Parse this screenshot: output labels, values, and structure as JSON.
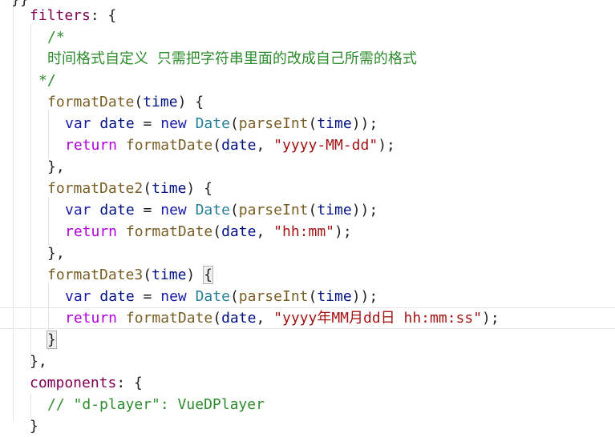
{
  "editor": {
    "lines": [
      {
        "text": "}}"
      },
      {
        "tokens": [
          {
            "t": "filters",
            "c": "prop"
          },
          {
            "t": ": {",
            "c": "punc"
          }
        ]
      },
      {
        "tokens": [
          {
            "t": "/*",
            "c": "cm"
          }
        ]
      },
      {
        "tokens": [
          {
            "t": "时间格式自定义 只需把字符串里面的改成自己所需的格式",
            "c": "cm"
          }
        ]
      },
      {
        "tokens": [
          {
            "t": "*/",
            "c": "cm"
          }
        ]
      },
      {
        "tokens": [
          {
            "t": "formatDate",
            "c": "fn"
          },
          {
            "t": "(",
            "c": "punc"
          },
          {
            "t": "time",
            "c": "id"
          },
          {
            "t": ") {",
            "c": "punc"
          }
        ]
      },
      {
        "tokens": [
          {
            "t": "var",
            "c": "kw"
          },
          {
            "t": " ",
            "c": "punc"
          },
          {
            "t": "date",
            "c": "id"
          },
          {
            "t": " = ",
            "c": "punc"
          },
          {
            "t": "new",
            "c": "kw"
          },
          {
            "t": " ",
            "c": "punc"
          },
          {
            "t": "Date",
            "c": "cls"
          },
          {
            "t": "(",
            "c": "punc"
          },
          {
            "t": "parseInt",
            "c": "fn"
          },
          {
            "t": "(",
            "c": "punc"
          },
          {
            "t": "time",
            "c": "id"
          },
          {
            "t": "));",
            "c": "punc"
          }
        ]
      },
      {
        "tokens": [
          {
            "t": "return",
            "c": "ctrl"
          },
          {
            "t": " ",
            "c": "punc"
          },
          {
            "t": "formatDate",
            "c": "fn"
          },
          {
            "t": "(",
            "c": "punc"
          },
          {
            "t": "date",
            "c": "id"
          },
          {
            "t": ", ",
            "c": "punc"
          },
          {
            "t": "\"yyyy-MM-dd\"",
            "c": "str"
          },
          {
            "t": ");",
            "c": "punc"
          }
        ]
      },
      {
        "tokens": [
          {
            "t": "},",
            "c": "punc"
          }
        ]
      },
      {
        "tokens": [
          {
            "t": "formatDate2",
            "c": "fn"
          },
          {
            "t": "(",
            "c": "punc"
          },
          {
            "t": "time",
            "c": "id"
          },
          {
            "t": ") {",
            "c": "punc"
          }
        ]
      },
      {
        "tokens": [
          {
            "t": "var",
            "c": "kw"
          },
          {
            "t": " ",
            "c": "punc"
          },
          {
            "t": "date",
            "c": "id"
          },
          {
            "t": " = ",
            "c": "punc"
          },
          {
            "t": "new",
            "c": "kw"
          },
          {
            "t": " ",
            "c": "punc"
          },
          {
            "t": "Date",
            "c": "cls"
          },
          {
            "t": "(",
            "c": "punc"
          },
          {
            "t": "parseInt",
            "c": "fn"
          },
          {
            "t": "(",
            "c": "punc"
          },
          {
            "t": "time",
            "c": "id"
          },
          {
            "t": "));",
            "c": "punc"
          }
        ]
      },
      {
        "tokens": [
          {
            "t": "return",
            "c": "ctrl"
          },
          {
            "t": " ",
            "c": "punc"
          },
          {
            "t": "formatDate",
            "c": "fn"
          },
          {
            "t": "(",
            "c": "punc"
          },
          {
            "t": "date",
            "c": "id"
          },
          {
            "t": ", ",
            "c": "punc"
          },
          {
            "t": "\"hh:mm\"",
            "c": "str"
          },
          {
            "t": ");",
            "c": "punc"
          }
        ]
      },
      {
        "tokens": [
          {
            "t": "},",
            "c": "punc"
          }
        ]
      },
      {
        "tokens": [
          {
            "t": "formatDate3",
            "c": "fn"
          },
          {
            "t": "(",
            "c": "punc"
          },
          {
            "t": "time",
            "c": "id"
          },
          {
            "t": ") ",
            "c": "punc"
          },
          {
            "t": "{",
            "c": "punc",
            "match": true
          }
        ]
      },
      {
        "tokens": [
          {
            "t": "var",
            "c": "kw"
          },
          {
            "t": " ",
            "c": "punc"
          },
          {
            "t": "date",
            "c": "id"
          },
          {
            "t": " = ",
            "c": "punc"
          },
          {
            "t": "new",
            "c": "kw"
          },
          {
            "t": " ",
            "c": "punc"
          },
          {
            "t": "Date",
            "c": "cls"
          },
          {
            "t": "(",
            "c": "punc"
          },
          {
            "t": "parseInt",
            "c": "fn"
          },
          {
            "t": "(",
            "c": "punc"
          },
          {
            "t": "time",
            "c": "id"
          },
          {
            "t": "));",
            "c": "punc"
          }
        ]
      },
      {
        "tokens": [
          {
            "t": "return",
            "c": "ctrl"
          },
          {
            "t": " ",
            "c": "punc"
          },
          {
            "t": "formatDate",
            "c": "fn"
          },
          {
            "t": "(",
            "c": "punc"
          },
          {
            "t": "date",
            "c": "id"
          },
          {
            "t": ", ",
            "c": "punc"
          },
          {
            "t": "\"yyyy年MM月dd日 hh:mm:ss\"",
            "c": "str"
          },
          {
            "t": ");",
            "c": "punc"
          }
        ]
      },
      {
        "tokens": [
          {
            "t": "}",
            "c": "punc",
            "match": true
          }
        ]
      },
      {
        "tokens": [
          {
            "t": "},",
            "c": "punc"
          }
        ]
      },
      {
        "tokens": [
          {
            "t": "components",
            "c": "prop"
          },
          {
            "t": ": {",
            "c": "punc"
          }
        ]
      },
      {
        "tokens": [
          {
            "t": "// \"d-player\": VueDPlayer",
            "c": "cm"
          }
        ]
      },
      {
        "tokens": [
          {
            "t": "}",
            "c": "punc"
          }
        ]
      }
    ]
  }
}
